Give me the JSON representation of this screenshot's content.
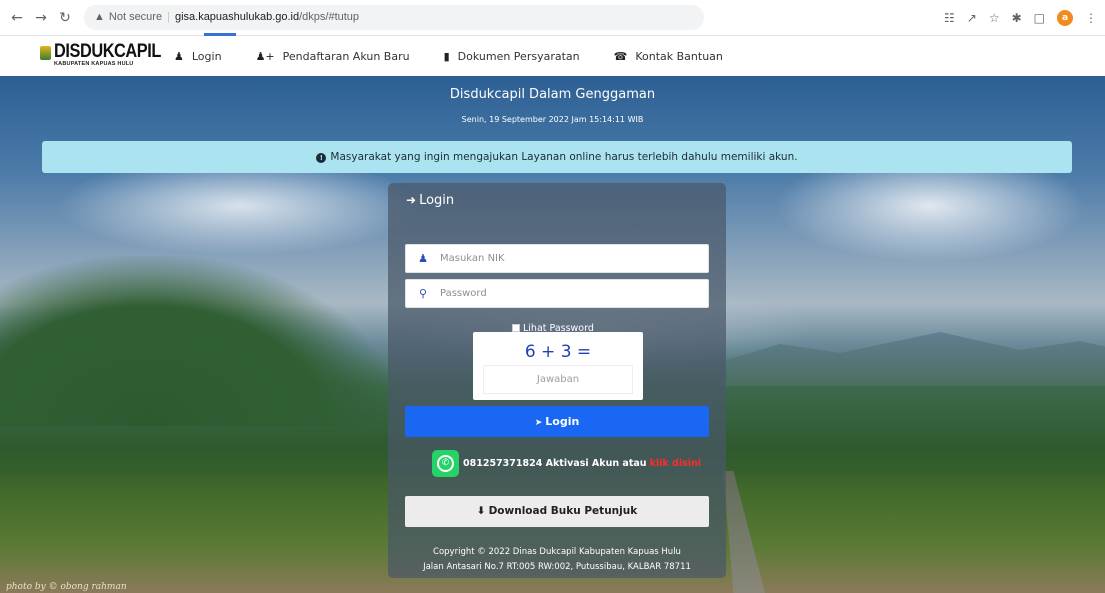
{
  "browser": {
    "security_label": "Not secure",
    "url_host": "gisa.kapuashulukab.go.id",
    "url_path": "/dkps/#tutup",
    "profile_initial": "a"
  },
  "brand": {
    "title": "DISDUKCAPIL",
    "subtitle": "KABUPATEN KAPUAS HULU"
  },
  "nav": [
    {
      "label": "Login",
      "icon": "user-icon"
    },
    {
      "label": "Pendaftaran Akun Baru",
      "icon": "user-plus-icon"
    },
    {
      "label": "Dokumen Persyaratan",
      "icon": "book-icon"
    },
    {
      "label": "Kontak Bantuan",
      "icon": "phone-icon"
    }
  ],
  "hero": {
    "title": "Disdukcapil Dalam Genggaman",
    "datetime": "Senin, 19 September 2022 Jam 15:14:11 WIB",
    "photo_credit": "photo by © obong rahman"
  },
  "alert": {
    "text": "Masyarakat yang ingin mengajukan Layanan online harus terlebih dahulu memiliki akun."
  },
  "login": {
    "title": "Login",
    "nik_placeholder": "Masukan NIK",
    "password_placeholder": "Password",
    "show_password_label": "Lihat Password",
    "captcha_question": "6 + 3 =",
    "captcha_placeholder": "Jawaban",
    "submit_label": "Login",
    "whatsapp_text": "081257371824 Aktivasi Akun atau",
    "whatsapp_link": "klik disini",
    "download_label": "Download Buku Petunjuk",
    "footer_line1": "Copyright © 2022 Dinas Dukcapil Kabupaten Kapuas Hulu",
    "footer_line2": "Jalan Antasari No.7 RT:005 RW:002, Putussibau, KALBAR 78711"
  },
  "colors": {
    "alert_bg": "#abe4f0",
    "login_button": "#1967f2",
    "whatsapp_green": "#25d366",
    "link_red": "#ff2a2a"
  }
}
